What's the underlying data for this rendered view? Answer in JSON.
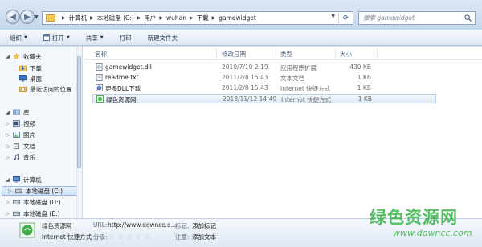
{
  "address": {
    "crumbs": [
      "计算机",
      "本地磁盘 (C:)",
      "用户",
      "wuhan",
      "下载",
      "gamewidget"
    ]
  },
  "search": {
    "placeholder": "搜索 gamewidget"
  },
  "toolbar": {
    "organize": "组织",
    "open": "打开",
    "share": "共享",
    "print": "打印",
    "new_folder": "新建文件夹"
  },
  "nav": {
    "favorites": "收藏夹",
    "downloads": "下载",
    "desktop": "桌面",
    "recent": "最近访问的位置",
    "libraries": "库",
    "videos": "视频",
    "pictures": "图片",
    "documents": "文档",
    "music": "音乐",
    "computer": "计算机",
    "disk_c": "本地磁盘 (C:)",
    "disk_d": "本地磁盘 (D:)",
    "disk_e": "本地磁盘 (E:)"
  },
  "columns": {
    "name": "名称",
    "date": "修改日期",
    "type": "类型",
    "size": "大小"
  },
  "files": [
    {
      "name": "gamewidget.dll",
      "date": "2010/7/10 2:19",
      "type": "应用程序扩展",
      "size": "430 KB"
    },
    {
      "name": "readme.txt",
      "date": "2011/2/8 15:43",
      "type": "文本文档",
      "size": "1 KB"
    },
    {
      "name": "更多DLL下载",
      "date": "2011/2/8 15:43",
      "type": "Internet 快捷方式",
      "size": "1 KB"
    },
    {
      "name": "绿色资源网",
      "date": "2018/11/12 14:49",
      "type": "Internet 快捷方式",
      "size": "1 KB"
    }
  ],
  "details": {
    "name": "绿色资源网",
    "type": "Internet 快捷方式",
    "url_label": "URL:",
    "url_value": "http://www.downcc.c...",
    "rating_label": "分级:",
    "tags_label": "标记:",
    "tags_value": "添加标记",
    "notes_label": "注意:",
    "notes_value": "添加文本",
    "rating": 0
  },
  "watermark": {
    "cn": "绿色资源网",
    "en": "www.downcc.com"
  },
  "colors": {
    "selection": "#cde0f6",
    "folder": "#f2c75c",
    "watermark": "#38b449"
  }
}
